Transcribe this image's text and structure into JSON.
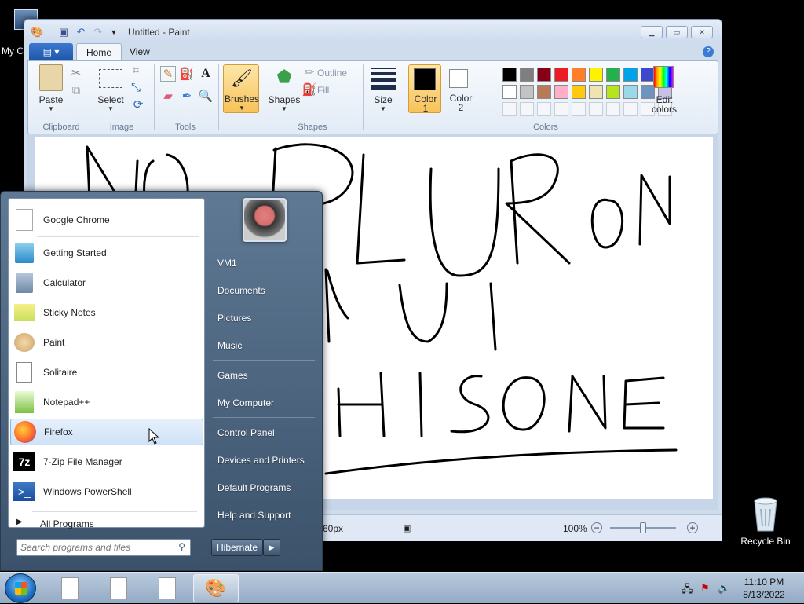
{
  "desktop": {
    "my_computer_label": "My C",
    "recycle_bin_label": "Recycle Bin"
  },
  "paint": {
    "title": "Untitled - Paint",
    "tabs": [
      "Home",
      "View"
    ],
    "groups": {
      "clipboard": "Clipboard",
      "image": "Image",
      "tools": "Tools",
      "shapes": "Shapes",
      "colors": "Colors"
    },
    "buttons": {
      "paste": "Paste",
      "select": "Select",
      "brushes": "Brushes",
      "shapes": "Shapes",
      "outline": "Outline",
      "fill": "Fill",
      "size": "Size",
      "color1_line1": "Color",
      "color1_line2": "1",
      "color2_line1": "Color",
      "color2_line2": "2",
      "edit_colors_line1": "Edit",
      "edit_colors_line2": "colors"
    },
    "palette_row1": [
      "#000000",
      "#7f7f7f",
      "#880015",
      "#ed1c24",
      "#ff7f27",
      "#fff200",
      "#22b14c",
      "#00a2e8",
      "#3f48cc",
      "#a349a4"
    ],
    "palette_row2": [
      "#ffffff",
      "#c3c3c3",
      "#b97a57",
      "#ffaec9",
      "#ffc90e",
      "#efe4b0",
      "#b5e61d",
      "#99d9ea",
      "#7092be",
      "#c8bfe7"
    ],
    "status": {
      "size_text": "60px",
      "zoom": "100%"
    },
    "zoom_level_fraction": 0.5
  },
  "start_menu": {
    "programs": [
      {
        "label": "Google Chrome",
        "icon": "document-icon"
      },
      {
        "label": "Getting Started",
        "icon": "getting-started-icon"
      },
      {
        "label": "Calculator",
        "icon": "calculator-icon"
      },
      {
        "label": "Sticky Notes",
        "icon": "sticky-notes-icon"
      },
      {
        "label": "Paint",
        "icon": "paint-icon"
      },
      {
        "label": "Solitaire",
        "icon": "solitaire-icon"
      },
      {
        "label": "Notepad++",
        "icon": "notepad-plus-icon"
      },
      {
        "label": "Firefox",
        "icon": "firefox-icon"
      },
      {
        "label": "7-Zip File Manager",
        "icon": "7zip-icon"
      },
      {
        "label": "Windows PowerShell",
        "icon": "powershell-icon"
      }
    ],
    "all_programs": "All Programs",
    "search_placeholder": "Search programs and files",
    "right_items": [
      "VM1",
      "Documents",
      "Pictures",
      "Music",
      "Games",
      "My Computer",
      "Control Panel",
      "Devices and Printers",
      "Default Programs",
      "Help and Support"
    ],
    "hibernate": "Hibernate"
  },
  "taskbar": {
    "time": "11:10 PM",
    "date": "8/13/2022"
  }
}
